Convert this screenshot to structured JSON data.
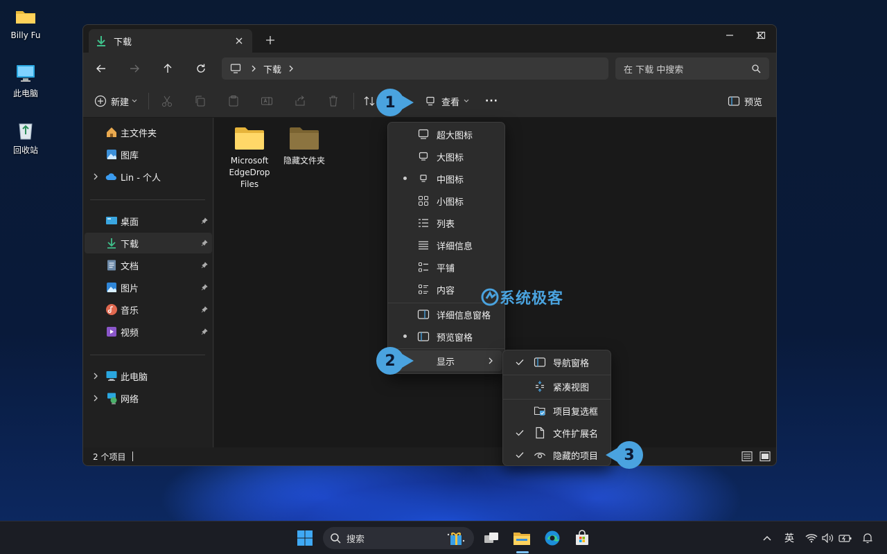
{
  "desktop": {
    "icons": [
      {
        "label": "Billy Fu"
      },
      {
        "label": "此电脑"
      },
      {
        "label": "回收站"
      }
    ]
  },
  "window": {
    "tab_title": "下载",
    "address": {
      "crumb": "下载"
    },
    "search_placeholder": "在 下载 中搜索",
    "toolbar": {
      "new_label": "新建",
      "view_label": "查看",
      "more_label": "···",
      "preview_label": "预览"
    },
    "sidebar": {
      "home": "主文件夹",
      "gallery": "图库",
      "onedrive": "Lin - 个人",
      "quick": [
        "桌面",
        "下载",
        "文档",
        "图片",
        "音乐",
        "视频"
      ],
      "this_pc": "此电脑",
      "network": "网络"
    },
    "files": [
      {
        "name": "Microsoft EdgeDrop Files"
      },
      {
        "name": "隐藏文件夹"
      }
    ],
    "status": {
      "item_count": "2 个项目"
    }
  },
  "view_menu": {
    "items": [
      {
        "label": "超大图标",
        "selected": false
      },
      {
        "label": "大图标",
        "selected": false
      },
      {
        "label": "中图标",
        "selected": true
      },
      {
        "label": "小图标",
        "selected": false
      },
      {
        "label": "列表",
        "selected": false
      },
      {
        "label": "详细信息",
        "selected": false
      },
      {
        "label": "平铺",
        "selected": false
      },
      {
        "label": "内容",
        "selected": false
      }
    ],
    "pane_items": [
      {
        "label": "详细信息窗格",
        "selected": false
      },
      {
        "label": "预览窗格",
        "selected": true
      }
    ],
    "show_label": "显示"
  },
  "show_menu": {
    "items": [
      {
        "label": "导航窗格",
        "checked": true
      },
      {
        "label": "紧凑视图",
        "checked": false
      },
      {
        "label": "项目复选框",
        "checked": false
      },
      {
        "label": "文件扩展名",
        "checked": true
      },
      {
        "label": "隐藏的项目",
        "checked": true
      }
    ]
  },
  "annotations": [
    "1",
    "2",
    "3"
  ],
  "watermark": "系统极客",
  "taskbar": {
    "search_label": "搜索",
    "ime_label": "英"
  },
  "colors": {
    "accent": "#4aa3df",
    "window_bg": "#202020",
    "menu_bg": "#2c2c2c"
  }
}
